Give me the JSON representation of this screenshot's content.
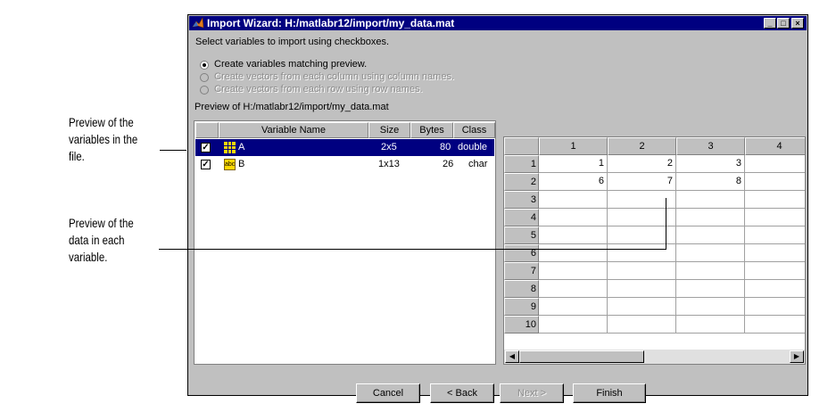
{
  "window": {
    "title": "Import Wizard: H:/matlabr12/import/my_data.mat",
    "minimize": "_",
    "maximize": "□",
    "close": "×"
  },
  "instructions": "Select variables to import using checkboxes.",
  "options": [
    {
      "label": "Create variables matching preview.",
      "selected": true,
      "enabled": true
    },
    {
      "label": "Create vectors from each column using column names.",
      "selected": false,
      "enabled": false
    },
    {
      "label": "Create vectors from each row using row names.",
      "selected": false,
      "enabled": false
    }
  ],
  "preview_label": "Preview of H:/matlabr12/import/my_data.mat",
  "variables_table": {
    "headers": [
      "",
      "Variable Name",
      "Size",
      "Bytes",
      "Class"
    ],
    "rows": [
      {
        "checked": true,
        "icon": "matrix-icon",
        "name": "A",
        "size": "2x5",
        "bytes": "80",
        "class": "double",
        "selected": true
      },
      {
        "checked": true,
        "icon": "char-icon",
        "icon_text": "abc",
        "name": "B",
        "size": "1x13",
        "bytes": "26",
        "class": "char",
        "selected": false
      }
    ]
  },
  "data_grid": {
    "col_headers": [
      "1",
      "2",
      "3",
      "4"
    ],
    "row_headers": [
      "1",
      "2",
      "3",
      "4",
      "5",
      "6",
      "7",
      "8",
      "9",
      "10"
    ],
    "cells": [
      [
        "1",
        "2",
        "3",
        ""
      ],
      [
        "6",
        "7",
        "8",
        ""
      ]
    ]
  },
  "buttons": {
    "cancel": "Cancel",
    "back": "< Back",
    "next": "Next >",
    "finish": "Finish"
  },
  "callouts": {
    "variables": [
      "Preview of the",
      "variables in the",
      "file."
    ],
    "data": [
      " Preview of the",
      "data in each",
      "variable."
    ]
  },
  "colors": {
    "titlebar": "#000080",
    "selection": "#000080",
    "face": "#c0c0c0"
  }
}
